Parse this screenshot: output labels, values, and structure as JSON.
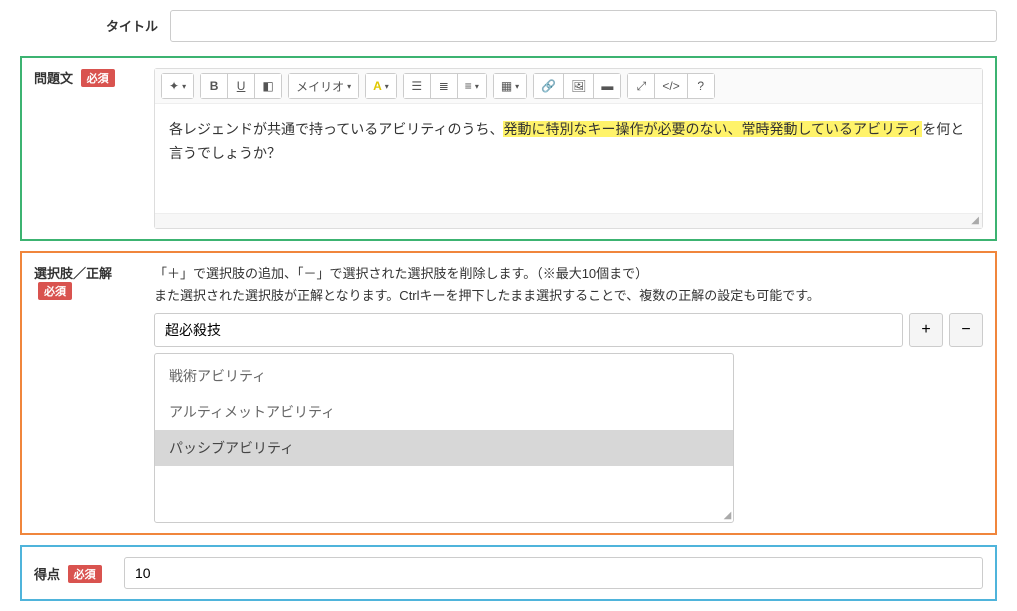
{
  "title": {
    "label": "タイトル",
    "value": ""
  },
  "required_badge": "必須",
  "question": {
    "label": "問題文",
    "toolbar": {
      "font_label": "メイリオ"
    },
    "body_prefix": "各レジェンドが共通で持っているアビリティのうち、",
    "body_highlight": "発動に特別なキー操作が必要のない、常時発動しているアビリティ",
    "body_suffix": "を何と言うでしょうか？"
  },
  "choices": {
    "label": "選択肢／正解",
    "help_line1": "「＋」で選択肢の追加、「－」で選択された選択肢を削除します。（※最大10個まで）",
    "help_line2": "また選択された選択肢が正解となります。Ctrlキーを押下したまま選択することで、複数の正解の設定も可能です。",
    "input_value": "超必殺技",
    "options": [
      {
        "text": "戦術アビリティ",
        "selected": false
      },
      {
        "text": "アルティメットアビリティ",
        "selected": false
      },
      {
        "text": "パッシブアビリティ",
        "selected": true
      }
    ]
  },
  "score": {
    "label": "得点",
    "value": "10"
  }
}
